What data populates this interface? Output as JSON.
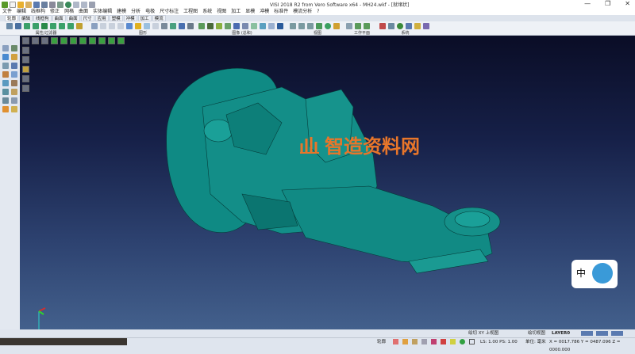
{
  "window": {
    "title": "VISI 2018 R2 from Vero Software x64 - MH24.wkf - [就绪状]",
    "minimize": "—",
    "maximize": "❐",
    "close": "✕"
  },
  "menu": [
    "文件",
    "编辑",
    "线框构",
    "修正",
    "网格",
    "曲面",
    "实体编辑",
    "建模",
    "分析",
    "电极",
    "尺寸标注",
    "工程图",
    "系统",
    "视图",
    "加工",
    "显模",
    "冲模",
    "标准件",
    "模流分析",
    "?"
  ],
  "tabs": [
    "轮廓",
    "编辑",
    "线框构",
    "曲面",
    "曲面",
    "尺寸",
    "应用",
    "塑模",
    "冲模",
    "加工",
    "模流"
  ],
  "active_tab": 0,
  "ribbon_groups": [
    "属性/过滤器",
    "图形",
    "图像 (总和)",
    "视图",
    "工作平面",
    "系统"
  ],
  "watermark": "智造资料网",
  "status": {
    "view_hint": "绘切 XY 上视图",
    "view_name": "绘切视图",
    "layer": "LAYER0",
    "mode": "轮廓",
    "ls_ps": "LS: 1.00 PS: 1.00",
    "unit": "单位: 毫米",
    "coords": "X = 0017.786 Y = 0487.096 Z = 0000.000"
  },
  "colors": {
    "model": "#0f8a84",
    "viewport_top": "#0a0d26",
    "viewport_bottom": "#43608c",
    "watermark": "#e8762a"
  }
}
